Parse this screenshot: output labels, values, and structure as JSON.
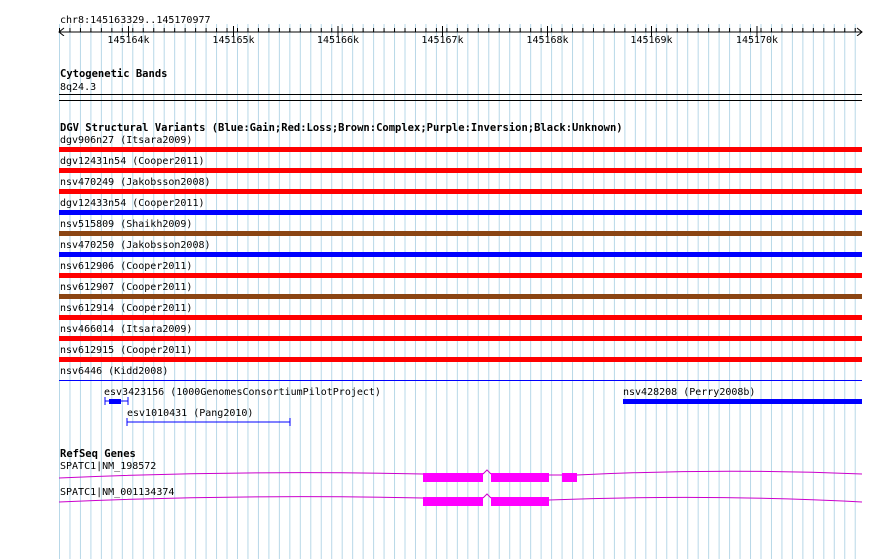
{
  "ruler": {
    "location": "chr8:145163329..145170977",
    "ticks": [
      "145164k",
      "145165k",
      "145166k",
      "145167k",
      "145168k",
      "145169k",
      "145170k"
    ]
  },
  "cytoband": {
    "title": "Cytogenetic Bands",
    "band": "8q24.3"
  },
  "dgv": {
    "title": "DGV Structural Variants (Blue:Gain;Red:Loss;Brown:Complex;Purple:Inversion;Black:Unknown)",
    "variants": [
      {
        "label": "dgv906n27 (Itsara2009)",
        "color": "#ff0000"
      },
      {
        "label": "dgv12431n54 (Cooper2011)",
        "color": "#ff0000"
      },
      {
        "label": "nsv470249 (Jakobsson2008)",
        "color": "#ff0000"
      },
      {
        "label": "dgv12433n54 (Cooper2011)",
        "color": "#0000ff"
      },
      {
        "label": "nsv515809 (Shaikh2009)",
        "color": "#8b4513"
      },
      {
        "label": "nsv470250 (Jakobsson2008)",
        "color": "#0000ff"
      },
      {
        "label": "nsv612906 (Cooper2011)",
        "color": "#ff0000"
      },
      {
        "label": "nsv612907 (Cooper2011)",
        "color": "#8b4513"
      },
      {
        "label": "nsv612914 (Cooper2011)",
        "color": "#ff0000"
      },
      {
        "label": "nsv466014 (Itsara2009)",
        "color": "#ff0000"
      },
      {
        "label": "nsv612915 (Cooper2011)",
        "color": "#ff0000"
      }
    ],
    "kidd_label": "nsv6446 (Kidd2008)",
    "esv1": "esv3423156 (1000GenomesConsortiumPilotProject)",
    "esv2": "esv1010431 (Pang2010)",
    "nsv_perry": "nsv428208 (Perry2008b)",
    "blue": "#0000ff"
  },
  "refseq": {
    "title": "RefSeq Genes",
    "genes": [
      {
        "label": "SPATC1|NM_198572"
      },
      {
        "label": "SPATC1|NM_001134374"
      }
    ],
    "exon_color": "#ff00ff"
  }
}
